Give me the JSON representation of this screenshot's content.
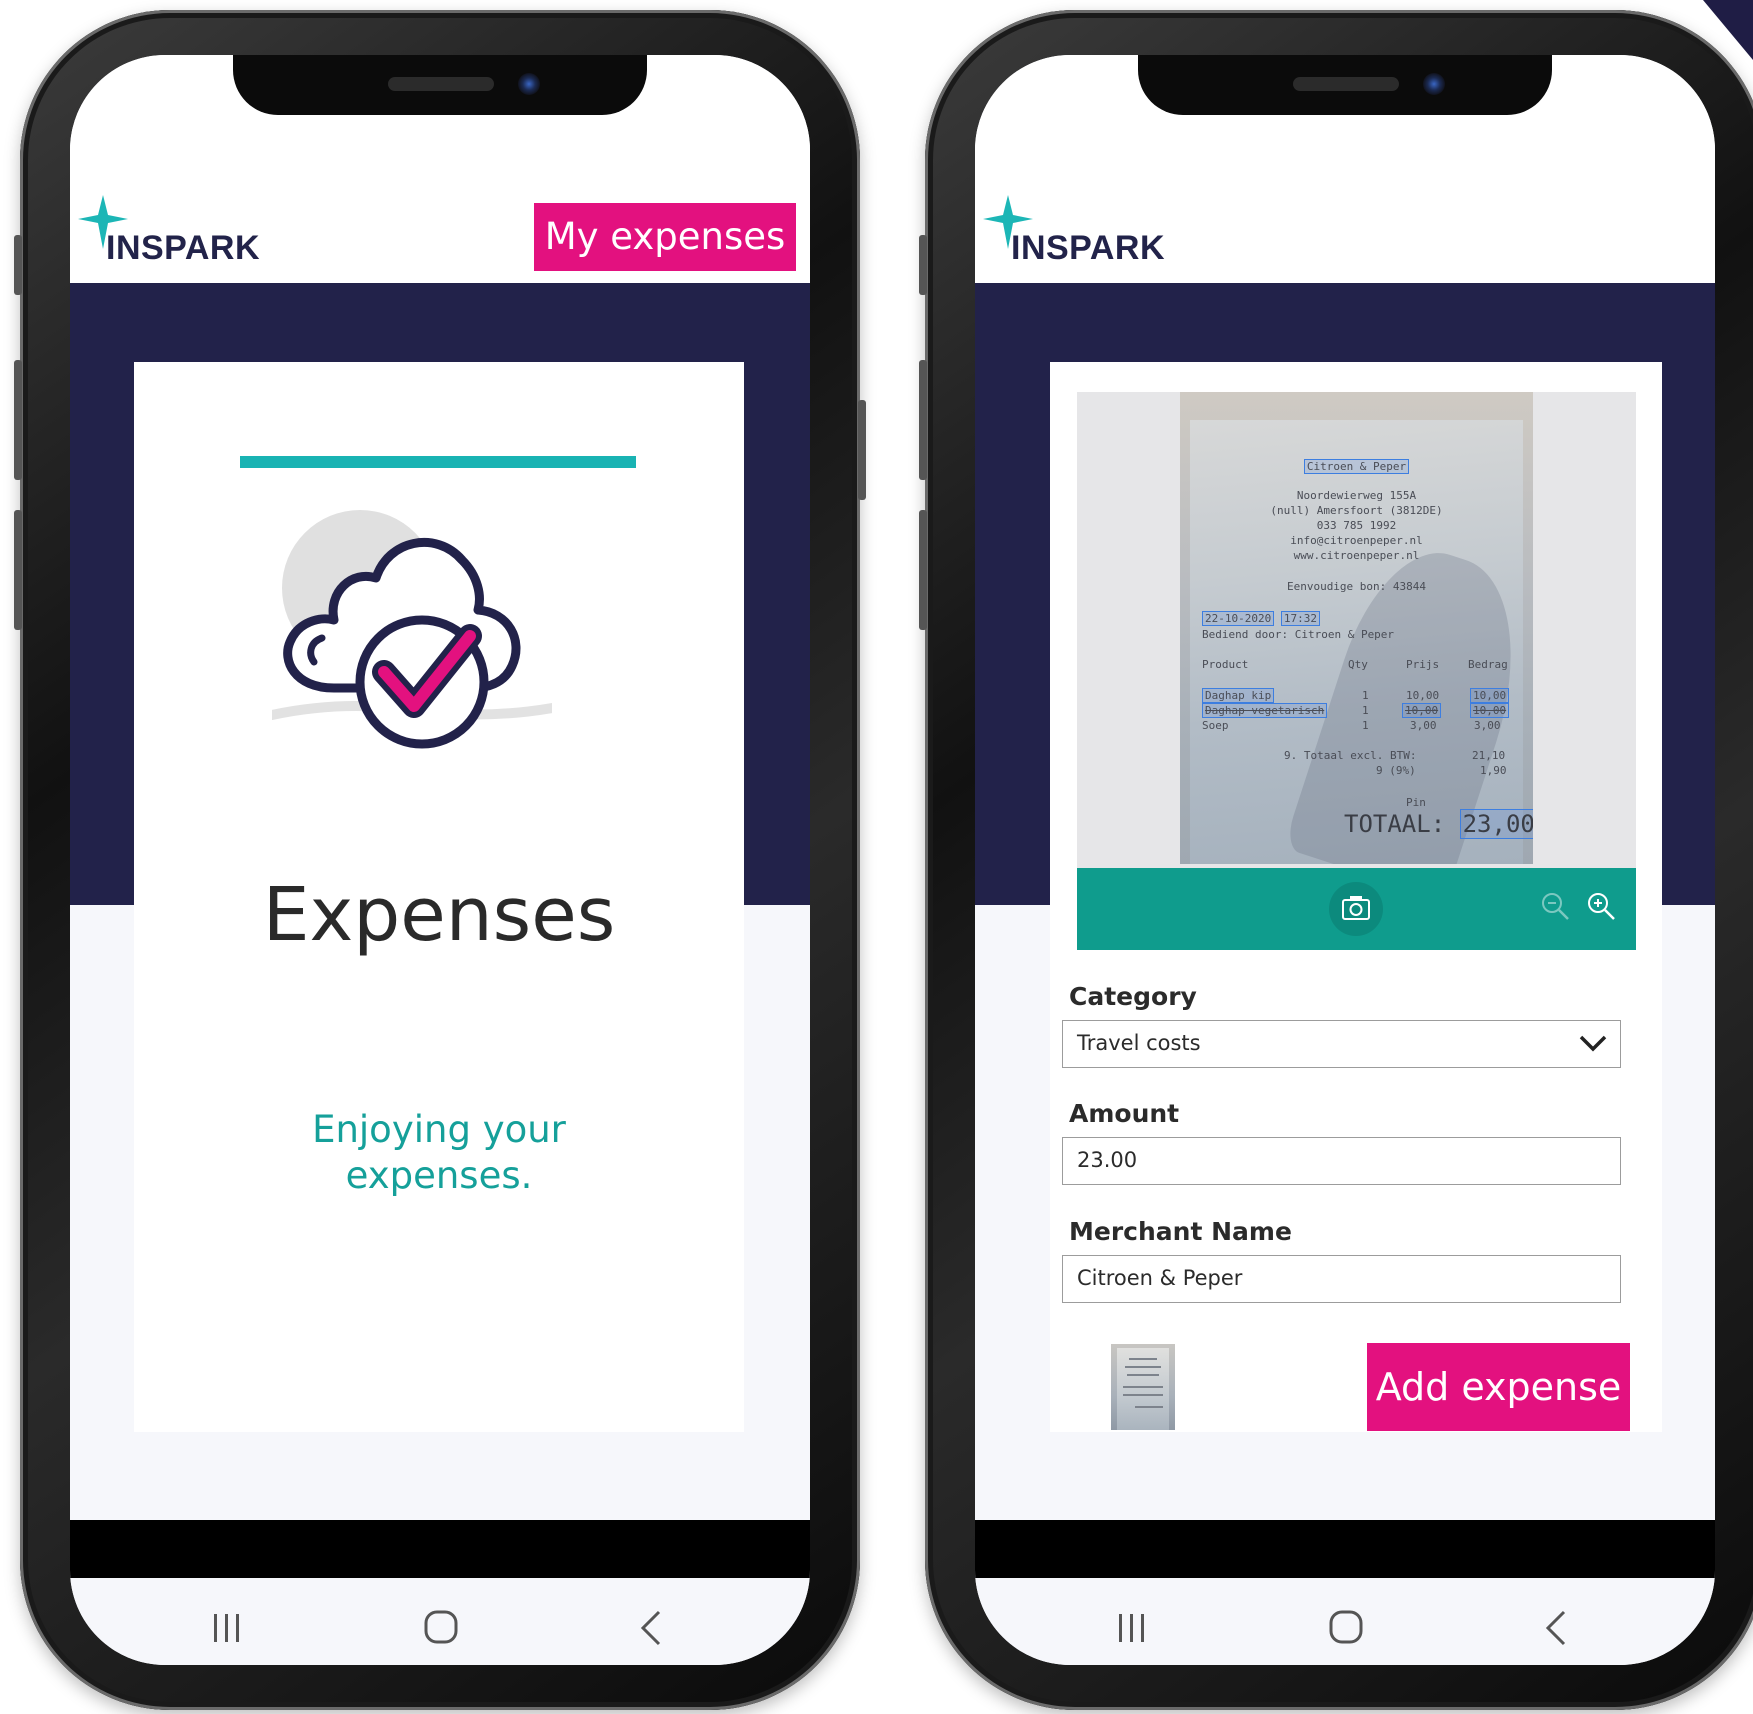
{
  "brand": {
    "logo_text": "INSPARK",
    "colors": {
      "navy": "#22224a",
      "magenta": "#e3117f",
      "teal": "#15a09a",
      "toolbar_teal": "#0f9c8d"
    }
  },
  "left_screen": {
    "header_button": "My expenses",
    "title": "Expenses",
    "subtitle": "Enjoying your expenses.",
    "illustration_icon": "cloud-check-icon"
  },
  "right_screen": {
    "receipt": {
      "merchant_box": "Citroen & Peper",
      "address_lines": [
        "Noordewierweg 155A",
        "(null) Amersfoort (3812DE)",
        "033 785 1992",
        "info@citroenpeper.nl",
        "www.citroenpeper.nl"
      ],
      "bon": "Eenvoudige bon: 43844",
      "date": "22-10-2020",
      "time": "17:32",
      "served_by": "Bediend door: Citroen & Peper",
      "col_product": "Product",
      "col_qty": "Qty",
      "col_price": "Prijs",
      "col_amount": "Bedrag",
      "items": [
        {
          "name": "Daghap kip",
          "qty": "1",
          "price": "10,00",
          "amount": "10,00"
        },
        {
          "name": "Daghap vegetarisch",
          "qty": "1",
          "price": "10,00",
          "amount": "10,00"
        },
        {
          "name": "Soep",
          "qty": "1",
          "price": "3,00",
          "amount": "3,00"
        }
      ],
      "subtotal_label": "9. Totaal excl. BTW:",
      "subtotal_value": "21,10",
      "vat_label": "9 (9%)",
      "vat_value": "1,90",
      "payment": "Pin",
      "total_label": "TOTAAL:",
      "total_value": "23,00"
    },
    "toolbar": {
      "camera_icon": "camera-icon",
      "zoom_out_icon": "zoom-out-icon",
      "zoom_in_icon": "zoom-in-icon"
    },
    "form": {
      "category_label": "Category",
      "category_value": "Travel costs",
      "amount_label": "Amount",
      "amount_value": "23.00",
      "merchant_label": "Merchant Name",
      "merchant_value": "Citroen & Peper",
      "submit_label": "Add expense"
    }
  },
  "nav": {
    "recents_icon": "recents-icon",
    "home_icon": "home-icon",
    "back_icon": "back-icon"
  }
}
